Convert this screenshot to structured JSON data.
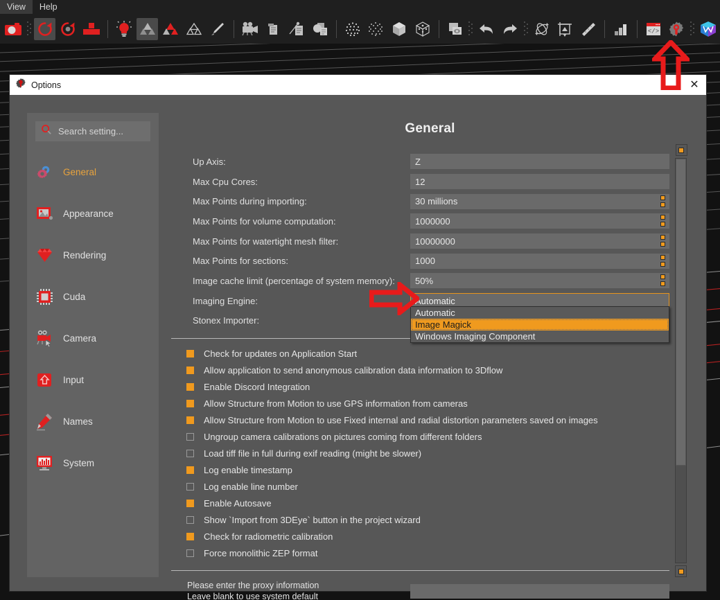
{
  "menubar": {
    "items": [
      {
        "label": "View"
      },
      {
        "label": "Help"
      }
    ]
  },
  "toolbar": {
    "icons": [
      {
        "name": "camera-icon",
        "active": false
      },
      {
        "name": "grip-handle",
        "active": false
      },
      {
        "name": "rotate-ccw-icon",
        "active": true
      },
      {
        "name": "rotate-cw-icon",
        "active": false
      },
      {
        "name": "blocks-abcd-icon",
        "active": false
      },
      {
        "name": "separator",
        "active": false
      },
      {
        "name": "lightbulb-icon",
        "active": false
      },
      {
        "name": "mesh-gray-icon",
        "active": true
      },
      {
        "name": "mesh-red-icon",
        "active": false
      },
      {
        "name": "mesh-outline-icon",
        "active": false
      },
      {
        "name": "paintbrush-icon",
        "active": false
      },
      {
        "name": "separator",
        "active": false
      },
      {
        "name": "movie-camera-icon",
        "active": false
      },
      {
        "name": "document-icon",
        "active": false
      },
      {
        "name": "document-measure-icon",
        "active": false
      },
      {
        "name": "document-shapes-icon",
        "active": false
      },
      {
        "name": "separator",
        "active": false
      },
      {
        "name": "dense-cloud-icon",
        "active": false
      },
      {
        "name": "sparse-cloud-icon",
        "active": false
      },
      {
        "name": "solid-cube-icon",
        "active": false
      },
      {
        "name": "wire-cube-icon",
        "active": false
      },
      {
        "name": "separator",
        "active": false
      },
      {
        "name": "image-preview-icon",
        "active": false
      },
      {
        "name": "grip-handle",
        "active": false
      },
      {
        "name": "undo-icon",
        "active": false
      },
      {
        "name": "redo-icon",
        "active": false
      },
      {
        "name": "grip-handle",
        "active": false
      },
      {
        "name": "orbit-icon",
        "active": false
      },
      {
        "name": "crop-icon",
        "active": false
      },
      {
        "name": "measure-ruler-icon",
        "active": false
      },
      {
        "name": "separator",
        "active": false
      },
      {
        "name": "bar-chart-icon",
        "active": false
      },
      {
        "name": "separator",
        "active": false
      },
      {
        "name": "code-window-icon",
        "active": false
      },
      {
        "name": "settings-wrench-icon",
        "active": false
      },
      {
        "name": "grip-handle",
        "active": false
      },
      {
        "name": "3dflow-cube-icon",
        "active": false
      }
    ]
  },
  "dialog": {
    "title": "Options",
    "close_label": "✕",
    "search": {
      "placeholder": "Search setting...",
      "value": ""
    },
    "nav": {
      "items": [
        {
          "label": "General",
          "icon": "gears-icon",
          "selected": true
        },
        {
          "label": "Appearance",
          "icon": "picture-icon",
          "selected": false
        },
        {
          "label": "Rendering",
          "icon": "gem-icon",
          "selected": false
        },
        {
          "label": "Cuda",
          "icon": "chip-icon",
          "selected": false
        },
        {
          "label": "Camera",
          "icon": "movie-camera-icon",
          "selected": false
        },
        {
          "label": "Input",
          "icon": "keycap-up-icon",
          "selected": false
        },
        {
          "label": "Names",
          "icon": "pencil-icon",
          "selected": false
        },
        {
          "label": "System",
          "icon": "monitor-chart-icon",
          "selected": false
        }
      ]
    },
    "pane": {
      "title": "General",
      "rows": [
        {
          "label": "Up Axis:",
          "value": "Z",
          "spinner": false
        },
        {
          "label": "Max Cpu Cores:",
          "value": "12",
          "spinner": false
        },
        {
          "label": "Max Points during importing:",
          "value": "30 millions",
          "spinner": true
        },
        {
          "label": "Max Points for volume computation:",
          "value": "1000000",
          "spinner": true
        },
        {
          "label": "Max Points for watertight mesh filter:",
          "value": "10000000",
          "spinner": true
        },
        {
          "label": "Max Points for sections:",
          "value": "1000",
          "spinner": true
        },
        {
          "label": "Image cache limit (percentage of system memory):",
          "value": "50%",
          "spinner": true
        }
      ],
      "combo": {
        "label": "Imaging Engine:",
        "value": "Automatic",
        "open": true,
        "options": [
          {
            "label": "Automatic",
            "highlighted": false
          },
          {
            "label": "Image Magick",
            "highlighted": true
          },
          {
            "label": "Windows Imaging Component",
            "highlighted": false
          }
        ]
      },
      "stonex_row": {
        "label": "Stonex Importer:",
        "value": ""
      },
      "checkboxes": [
        {
          "label": "Check for updates on Application Start",
          "checked": true
        },
        {
          "label": "Allow application to send anonymous calibration data information to 3Dflow",
          "checked": true
        },
        {
          "label": "Enable Discord Integration",
          "checked": true
        },
        {
          "label": "Allow Structure from Motion to use GPS information from cameras",
          "checked": true
        },
        {
          "label": "Allow Structure from Motion to use Fixed internal and radial distortion parameters saved on images",
          "checked": true
        },
        {
          "label": "Ungroup camera calibrations on pictures coming from different folders",
          "checked": false
        },
        {
          "label": "Load tiff file in full during exif reading (might be slower)",
          "checked": false
        },
        {
          "label": "Log enable timestamp",
          "checked": true
        },
        {
          "label": "Log enable line number",
          "checked": false
        },
        {
          "label": "Enable Autosave",
          "checked": true
        },
        {
          "label": "Show `Import from 3DEye` button in the project wizard",
          "checked": false
        },
        {
          "label": "Check for radiometric calibration",
          "checked": true
        },
        {
          "label": "Force monolithic ZEP format",
          "checked": false
        }
      ],
      "proxy": {
        "line1": "Please enter the proxy information",
        "line2": "Leave blank to use system default",
        "value": ""
      }
    }
  },
  "annotations": [
    {
      "name": "arrow-up-to-settings-button",
      "color": "#e81b1b"
    },
    {
      "name": "arrow-right-to-imaging-engine",
      "color": "#e81b1b"
    }
  ],
  "colors": {
    "accent_orange": "#f09a1e",
    "highlight_orange": "#e8951c",
    "dialog_bg": "#575757",
    "panel_bg": "#636363",
    "field_bg": "#6a6a6a",
    "selected_nav_text": "#e8a33d",
    "annotation_red": "#e81b1b"
  }
}
